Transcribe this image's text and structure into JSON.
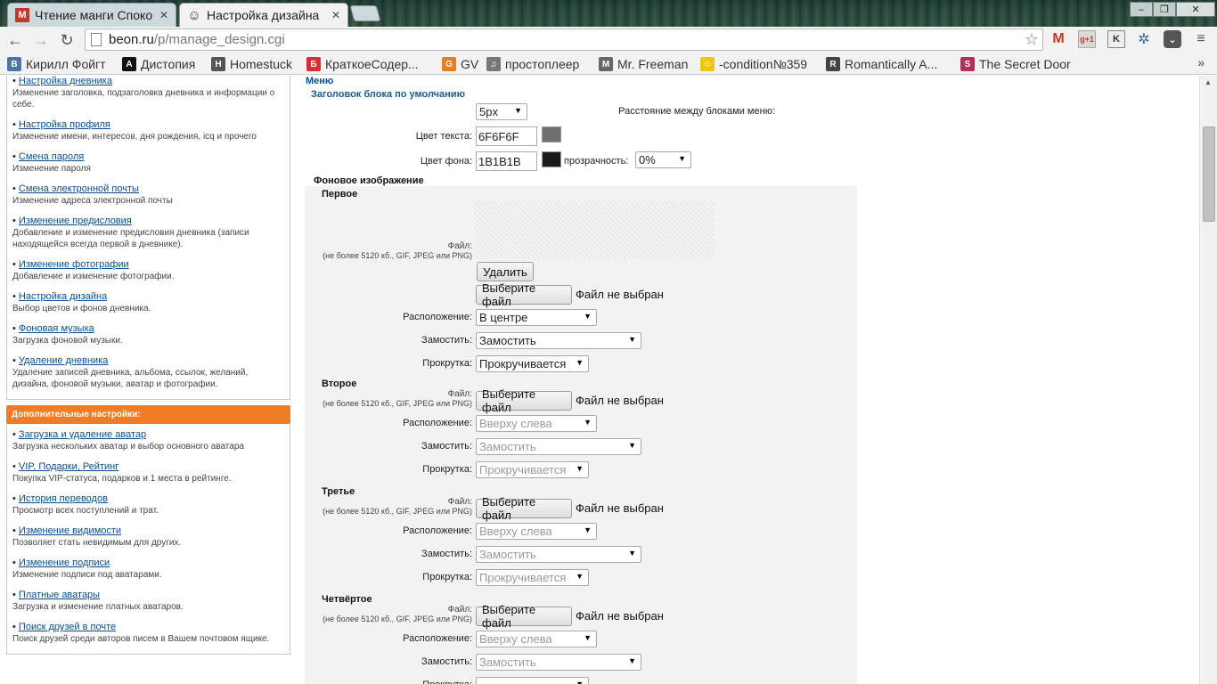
{
  "browser": {
    "tabs": [
      {
        "title": "Чтение манги Споко",
        "favicon": "manga-m-icon",
        "color": "#c0392b"
      },
      {
        "title": "Настройка дизайна",
        "favicon": "smiley-icon",
        "color": "#f1c40f"
      }
    ],
    "url_host": "beon.ru",
    "url_path": "/p/manage_design.cgi",
    "window_controls": {
      "minimize": "‒",
      "maximize": "❐",
      "close": "✕"
    },
    "extensions": [
      "gmail-icon",
      "gplus-icon",
      "k-icon",
      "cluster-icon",
      "pocket-icon",
      "menu-icon"
    ],
    "bookmarks": [
      {
        "label": "Кирилл Фойгт",
        "icon": "vk-icon",
        "color": "#4a76a8",
        "glyph": "В"
      },
      {
        "label": "Дистопия",
        "icon": "a-icon",
        "color": "#111111",
        "glyph": "A"
      },
      {
        "label": "Homestuck",
        "icon": "homestuck-icon",
        "color": "#555555",
        "glyph": "H"
      },
      {
        "label": "КраткоеСодер...",
        "icon": "b-icon",
        "color": "#d63031",
        "glyph": "Б"
      },
      {
        "label": "GV",
        "icon": "gv-icon",
        "color": "#e67e22",
        "glyph": "G"
      },
      {
        "label": "простоплеер",
        "icon": "sound-icon",
        "color": "#777777",
        "glyph": "♫"
      },
      {
        "label": "Mr. Freeman",
        "icon": "freeman-icon",
        "color": "#666666",
        "glyph": "M"
      },
      {
        "label": "-condition№359",
        "icon": "smiley-icon",
        "color": "#f1c40f",
        "glyph": "☺"
      },
      {
        "label": "Romantically A...",
        "icon": "ra-icon",
        "color": "#444444",
        "glyph": "R"
      },
      {
        "label": "The Secret Door",
        "icon": "secret-door-icon",
        "color": "#b03060",
        "glyph": "S"
      }
    ],
    "bookmarks_more": "»"
  },
  "sidebar": {
    "items_top": [
      {
        "link": "Настройка дневника",
        "desc": "Изменение заголовка, подзаголовка дневника и информации о себе."
      },
      {
        "link": "Настройка профиля",
        "desc": "Изменение имени, интересов, дня рождения, icq и прочего"
      },
      {
        "link": "Смена пароля",
        "desc": "Изменение пароля"
      },
      {
        "link": "Смена электронной почты",
        "desc": "Изменение адреса электронной почты"
      },
      {
        "link": "Изменение предисловия",
        "desc": "Добавление и изменение предисловия дневника (записи находящейся всегда первой в дневнике)."
      },
      {
        "link": "Изменение фотографии",
        "desc": "Добавление и изменение фотографии."
      },
      {
        "link": "Настройка дизайна",
        "desc": "Выбор цветов и фонов дневника."
      },
      {
        "link": "Фоновая музыка",
        "desc": "Загрузка фоновой музыки."
      },
      {
        "link": "Удаление дневника",
        "desc": "Удаление записей дневника, альбома, ссылок, желаний, дизайна, фоновой музыки, аватар и фотографии."
      }
    ],
    "extra_header": "Дополнительные настройки:",
    "items_extra": [
      {
        "link": "Загрузка и удаление аватар",
        "desc": "Загрузка нескольких аватар и выбор основного аватара"
      },
      {
        "link": "VIP, Подарки, Рейтинг",
        "desc": "Покупка VIP-статуса, подарков и 1 места в рейтинге."
      },
      {
        "link": "История переводов",
        "desc": "Просмотр всех поступлений и трат."
      },
      {
        "link": "Изменение видимости",
        "desc": "Позволяет стать невидимым для других."
      },
      {
        "link": "Изменение подписи",
        "desc": "Изменение подписи под аватарами."
      },
      {
        "link": "Платные аватары",
        "desc": "Загрузка и изменение платных аватаров."
      },
      {
        "link": "Поиск друзей в почте",
        "desc": "Поиск друзей среди авторов писем в Вашем почтовом ящике."
      }
    ]
  },
  "main": {
    "menu_title": "Меню",
    "block_title": "Заголовок блока по умолчанию",
    "spacing_label": "Расстояние между блоками меню:",
    "spacing_value": "5px",
    "text_color_label": "Цвет текста:",
    "text_color_value": "6F6F6F",
    "text_color_swatch": "#6f6f6f",
    "bg_color_label": "Цвет фона:",
    "bg_color_value": "1B1B1B",
    "bg_color_swatch": "#1b1b1b",
    "opacity_label": "прозрачность:",
    "opacity_value": "0%",
    "bg_image_title": "Фоновое изображение",
    "file_label": "Файл:",
    "file_note": "(не более 5120 кб., GIF, JPEG или PNG)",
    "delete_button": "Удалить",
    "choose_file_button": "Выберите файл",
    "no_file": "Файл не выбран",
    "position_label": "Расположение:",
    "tile_label": "Замостить:",
    "scroll_label": "Прокрутка:",
    "sections": [
      {
        "title": "Первое",
        "position": "В центре",
        "tile": "Замостить",
        "scroll": "Прокручивается"
      },
      {
        "title": "Второе",
        "position": "Вверху слева",
        "tile": "Замостить",
        "scroll": "Прокручивается"
      },
      {
        "title": "Третье",
        "position": "Вверху слева",
        "tile": "Замостить",
        "scroll": "Прокручивается"
      },
      {
        "title": "Четвёртое",
        "position": "Вверху слева",
        "tile": "Замостить",
        "scroll": ""
      }
    ]
  }
}
